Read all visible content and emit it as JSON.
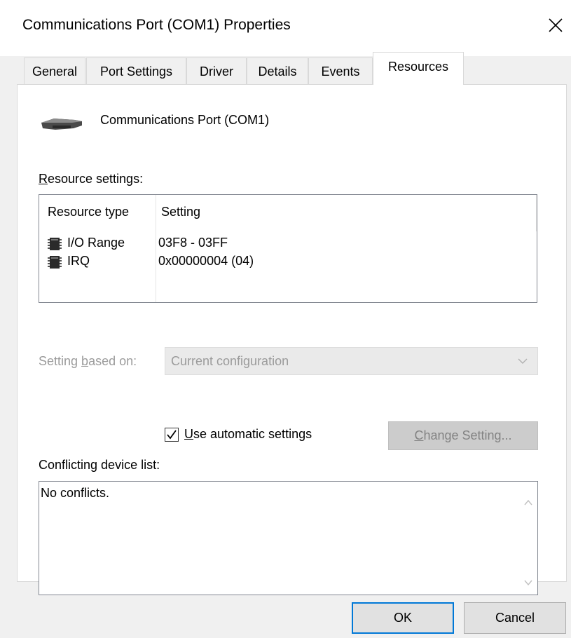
{
  "window": {
    "title": "Communications Port (COM1) Properties"
  },
  "tabs": [
    {
      "label": "General"
    },
    {
      "label": "Port Settings"
    },
    {
      "label": "Driver"
    },
    {
      "label": "Details"
    },
    {
      "label": "Events"
    },
    {
      "label": "Resources",
      "selected": true
    }
  ],
  "device": {
    "name": "Communications Port (COM1)",
    "icon": "serial-port-icon"
  },
  "resource_settings": {
    "label_underlined": "R",
    "label_rest": "esource settings:",
    "columns": {
      "type": "Resource type",
      "setting": "Setting"
    },
    "rows": [
      {
        "type": "I/O Range",
        "setting": "03F8 - 03FF",
        "icon": "chip-icon"
      },
      {
        "type": "IRQ",
        "setting": "0x00000004 (04)",
        "icon": "chip-icon"
      }
    ]
  },
  "setting_based_on": {
    "label_pre": "Setting ",
    "label_underlined": "b",
    "label_post": "ased on:",
    "value": "Current configuration",
    "enabled": false
  },
  "automatic": {
    "checked": true,
    "label_underlined": "U",
    "label_rest": "se automatic settings"
  },
  "change_setting": {
    "label_underlined": "C",
    "label_rest": "hange Setting...",
    "enabled": false
  },
  "conflicts": {
    "label": "Conflicting device list:",
    "text": "No conflicts."
  },
  "buttons": {
    "ok": "OK",
    "cancel": "Cancel"
  },
  "colors": {
    "accent": "#0078d7",
    "panel_bg": "#f0f0f0",
    "disabled_text": "#9b9b9b"
  }
}
